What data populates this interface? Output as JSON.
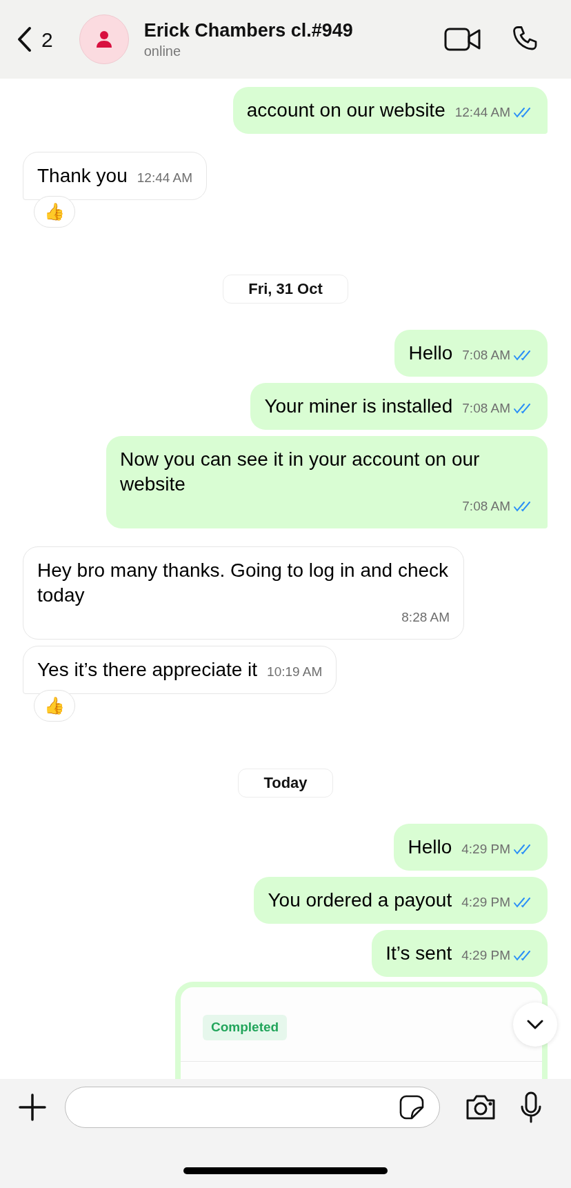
{
  "header": {
    "back_count": "2",
    "name": "Erick Chambers cl.#949",
    "status": "online"
  },
  "items": [
    {
      "kind": "message",
      "incoming": false,
      "text": "account on our website",
      "time": "12:44 AM",
      "read": true,
      "tail": true
    },
    {
      "kind": "message",
      "incoming": true,
      "text": "Thank you",
      "time": "12:44 AM",
      "tail": true,
      "reaction": "👍"
    },
    {
      "kind": "date",
      "text": "Fri, 31 Oct"
    },
    {
      "kind": "message",
      "incoming": false,
      "text": "Hello",
      "time": "7:08 AM",
      "read": true,
      "tail": false
    },
    {
      "kind": "message",
      "incoming": false,
      "text": "Your miner is installed",
      "time": "7:08 AM",
      "read": true,
      "tail": false
    },
    {
      "kind": "message",
      "incoming": false,
      "text": "Now you can see it in your account on our website",
      "time": "7:08 AM",
      "read": true,
      "tail": true
    },
    {
      "kind": "message",
      "incoming": true,
      "text": "Hey bro many thanks. Going to log in and check today",
      "time": "8:28 AM",
      "tail": false
    },
    {
      "kind": "message",
      "incoming": true,
      "text": "Yes it’s there appreciate it",
      "time": "10:19 AM",
      "tail": true,
      "reaction": "👍"
    },
    {
      "kind": "date",
      "text": "Today"
    },
    {
      "kind": "message",
      "incoming": false,
      "text": "Hello",
      "time": "4:29 PM",
      "read": true,
      "tail": false
    },
    {
      "kind": "message",
      "incoming": false,
      "text": "You ordered a payout",
      "time": "4:29 PM",
      "read": true,
      "tail": false
    },
    {
      "kind": "message",
      "incoming": false,
      "text": "It’s sent",
      "time": "4:29 PM",
      "read": true,
      "tail": false
    },
    {
      "kind": "card",
      "status": "Completed"
    }
  ]
}
